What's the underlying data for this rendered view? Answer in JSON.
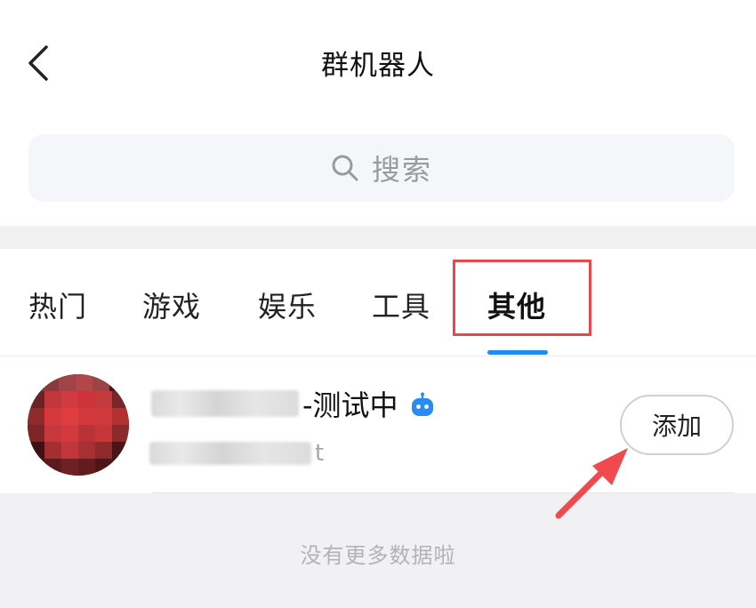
{
  "header": {
    "title": "群机器人",
    "back_icon": "chevron-left-icon"
  },
  "search": {
    "placeholder": "搜索",
    "icon": "search-icon"
  },
  "tabs": [
    {
      "label": "热门",
      "active": false
    },
    {
      "label": "游戏",
      "active": false
    },
    {
      "label": "娱乐",
      "active": false
    },
    {
      "label": "工具",
      "active": false
    },
    {
      "label": "其他",
      "active": true
    }
  ],
  "bot": {
    "name_visible": "-测试中",
    "desc_visible": "t",
    "badge_icon": "robot-icon",
    "add_label": "添加"
  },
  "footer": {
    "text": "没有更多数据啦"
  },
  "colors": {
    "accent": "#1e8cf0",
    "annotation": "#e8484c",
    "muted": "#9a9a9a"
  }
}
